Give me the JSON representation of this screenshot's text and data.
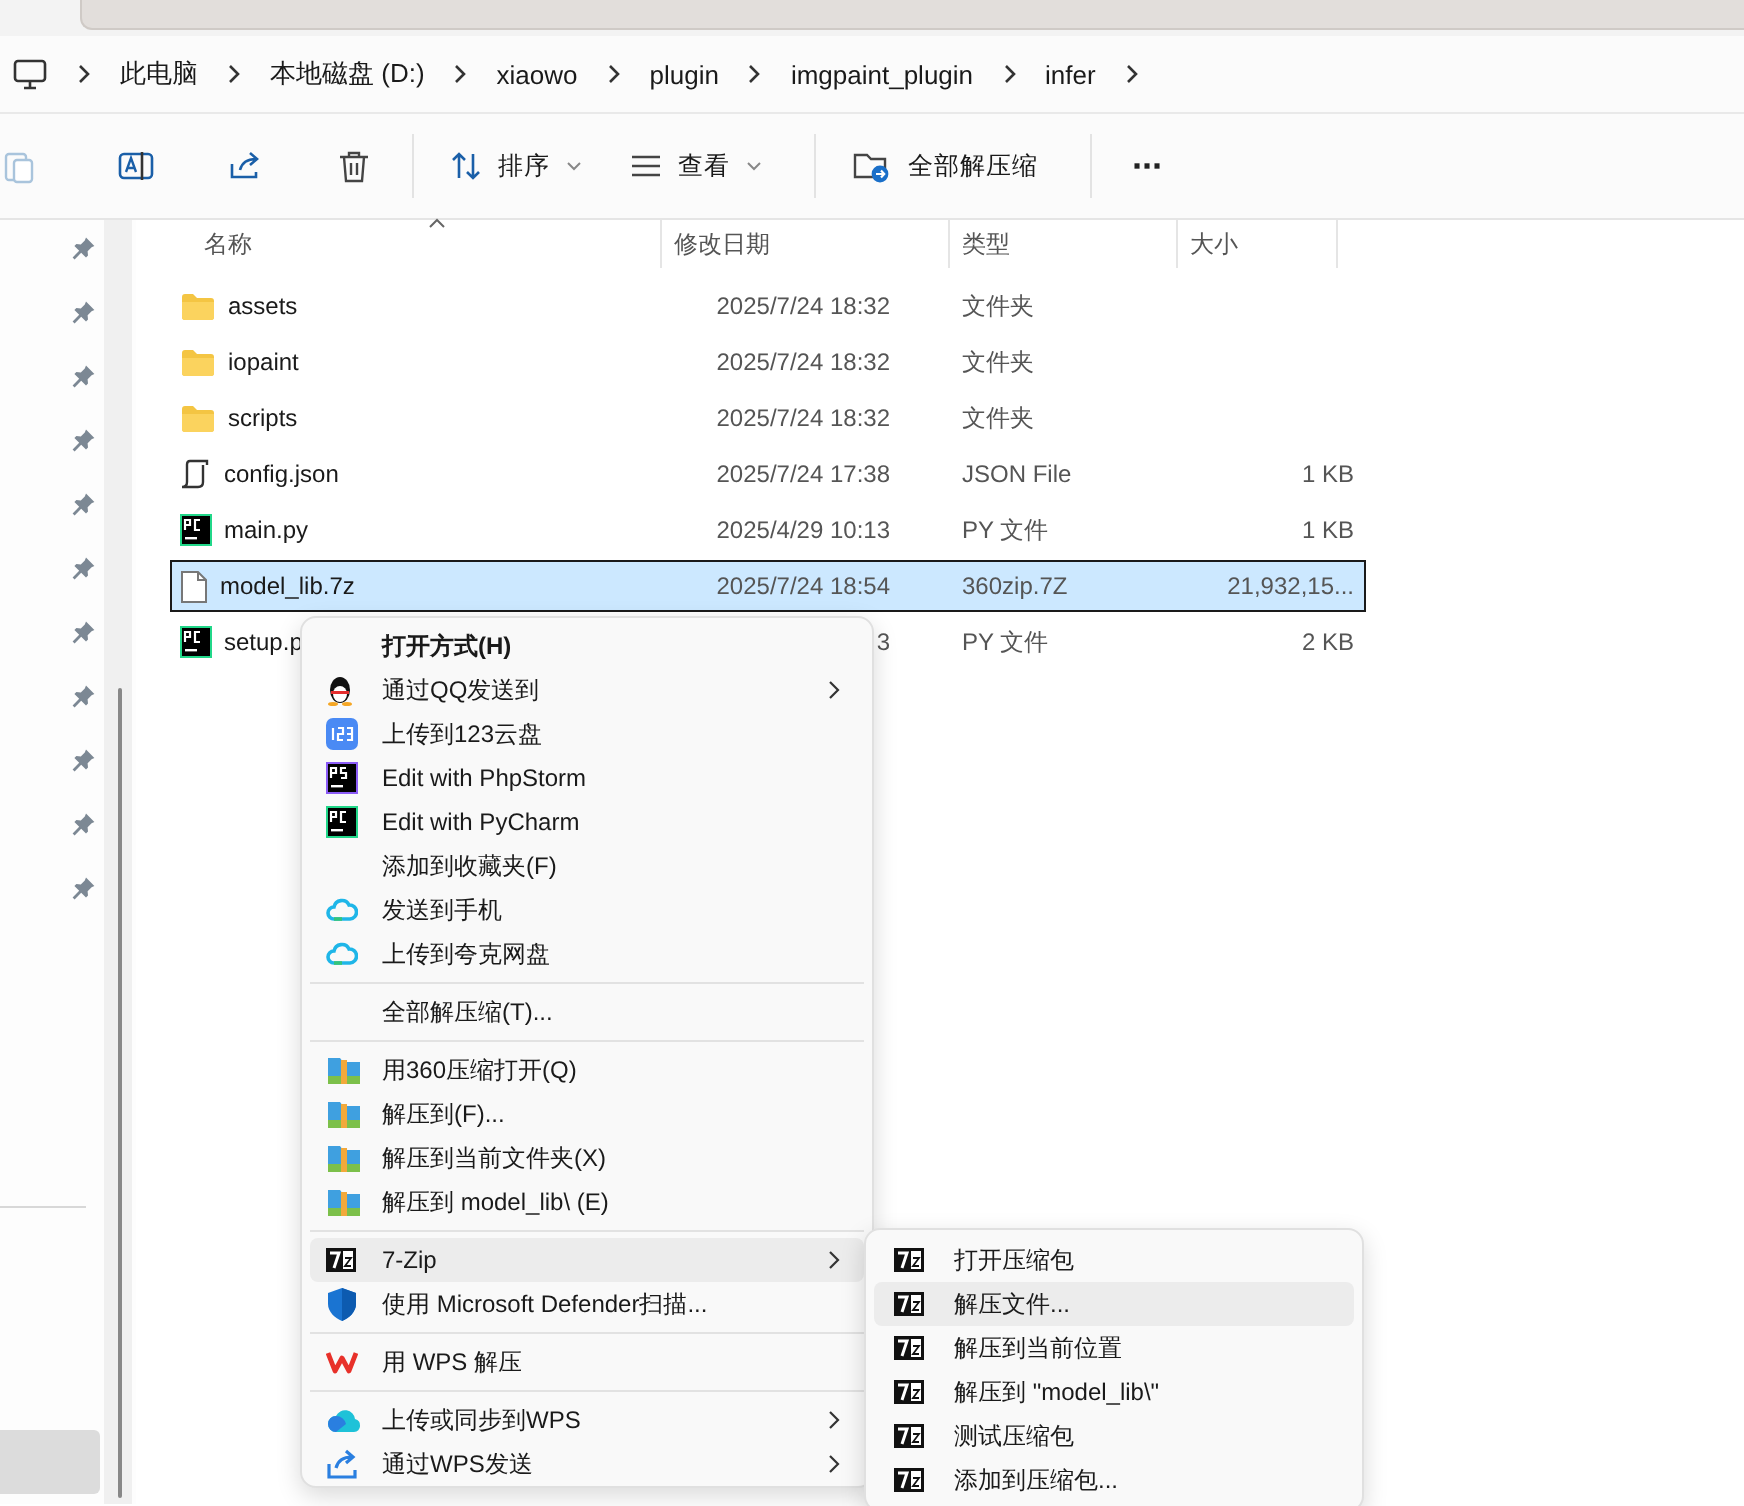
{
  "breadcrumb": [
    "此电脑",
    "本地磁盘 (D:)",
    "xiaowo",
    "plugin",
    "imgpaint_plugin",
    "infer"
  ],
  "toolbar": [
    {
      "kind": "paste"
    },
    {
      "kind": "rename"
    },
    {
      "kind": "share"
    },
    {
      "kind": "delete"
    },
    {
      "kind": "sort",
      "label": "排序"
    },
    {
      "kind": "view",
      "label": "查看"
    },
    {
      "kind": "extract",
      "label": "全部解压缩"
    },
    {
      "kind": "more",
      "label": "···"
    }
  ],
  "table": {
    "columns": [
      "名称",
      "修改日期",
      "类型",
      "大小"
    ],
    "rows": [
      {
        "kind": "folder",
        "name": "assets",
        "date": "2025/7/24 18:32",
        "type": "文件夹",
        "selected": false
      },
      {
        "kind": "folder",
        "name": "iopaint",
        "date": "2025/7/24 18:32",
        "type": "文件夹",
        "selected": false
      },
      {
        "kind": "folder",
        "name": "scripts",
        "date": "2025/7/24 18:32",
        "type": "文件夹",
        "selected": false
      },
      {
        "kind": "script",
        "name": "config.json",
        "date": "2025/7/24 17:38",
        "type": "JSON File",
        "size": "1 KB",
        "selected": false
      },
      {
        "kind": "python",
        "name": "main.py",
        "date": "2025/4/29 10:13",
        "type": "PY 文件",
        "size": "1 KB",
        "selected": false
      },
      {
        "kind": "file",
        "name": "model_lib.7z",
        "date": "2025/7/24 18:54",
        "type": "360zip.7Z",
        "size": "21,932,15...",
        "selected": true
      },
      {
        "kind": "python",
        "name": "setup.p",
        "date": "3",
        "type": "PY 文件",
        "size": "2 KB",
        "selected": false
      }
    ]
  },
  "context_menu": [
    {
      "kind": "plain",
      "label": "打开方式(H)",
      "default": true,
      "submenu": false,
      "highlighted": false
    },
    {
      "kind": "qq",
      "label": "通过QQ发送到",
      "default": false,
      "submenu": true,
      "highlighted": false
    },
    {
      "kind": "drive123",
      "label": "上传到123云盘",
      "default": false,
      "submenu": false,
      "highlighted": false
    },
    {
      "kind": "phpstorm",
      "label": "Edit with PhpStorm",
      "default": false,
      "submenu": false,
      "highlighted": false
    },
    {
      "kind": "pycharm",
      "label": "Edit with PyCharm",
      "default": false,
      "submenu": false,
      "highlighted": false
    },
    {
      "kind": "plain",
      "label": "添加到收藏夹(F)",
      "default": false,
      "submenu": false,
      "highlighted": false
    },
    {
      "kind": "cloud",
      "label": "发送到手机",
      "default": false,
      "submenu": false,
      "highlighted": false
    },
    {
      "kind": "cloud",
      "label": "上传到夸克网盘",
      "default": false,
      "submenu": false,
      "highlighted": false
    },
    {
      "kind": "separator"
    },
    {
      "kind": "plain",
      "label": "全部解压缩(T)...",
      "default": false,
      "submenu": false,
      "highlighted": false
    },
    {
      "kind": "separator"
    },
    {
      "kind": "archive",
      "label": "用360压缩打开(Q)",
      "default": false,
      "submenu": false,
      "highlighted": false
    },
    {
      "kind": "archive",
      "label": "解压到(F)...",
      "default": false,
      "submenu": false,
      "highlighted": false
    },
    {
      "kind": "archive",
      "label": "解压到当前文件夹(X)",
      "default": false,
      "submenu": false,
      "highlighted": false
    },
    {
      "kind": "archive",
      "label": "解压到 model_lib\\ (E)",
      "default": false,
      "submenu": false,
      "highlighted": false
    },
    {
      "kind": "separator"
    },
    {
      "kind": "sevenzip",
      "label": "7-Zip",
      "default": false,
      "submenu": true,
      "highlighted": true
    },
    {
      "kind": "shield",
      "label": "使用 Microsoft Defender扫描...",
      "default": false,
      "submenu": false,
      "highlighted": false
    },
    {
      "kind": "separator"
    },
    {
      "kind": "wps",
      "label": "用 WPS 解压",
      "default": false,
      "submenu": false,
      "highlighted": false
    },
    {
      "kind": "separator"
    },
    {
      "kind": "wpscloud",
      "label": "上传或同步到WPS",
      "default": false,
      "submenu": true,
      "highlighted": false
    },
    {
      "kind": "send",
      "label": "通过WPS发送",
      "default": false,
      "submenu": true,
      "highlighted": false
    }
  ],
  "submenu": [
    {
      "label": "打开压缩包",
      "highlighted": false
    },
    {
      "label": "解压文件...",
      "highlighted": true
    },
    {
      "label": "解压到当前位置",
      "highlighted": false
    },
    {
      "label": "解压到 \"model_lib\\\"",
      "highlighted": false
    },
    {
      "label": "测试压缩包",
      "highlighted": false
    },
    {
      "label": "添加到压缩包...",
      "highlighted": false
    }
  ]
}
